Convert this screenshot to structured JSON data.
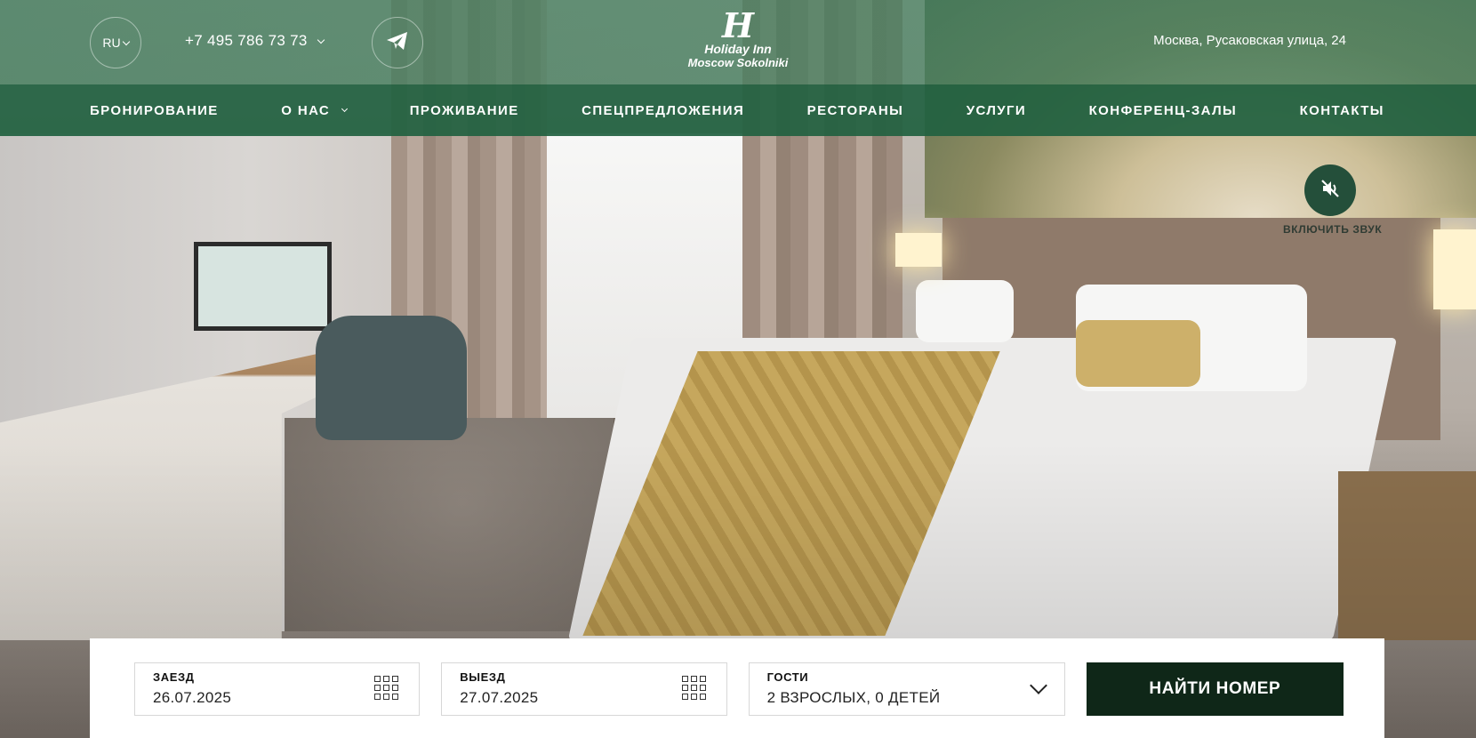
{
  "header": {
    "language": "RU",
    "phone": "+7 495 786 73 73",
    "logo": {
      "mark": "H",
      "brand": "Holiday Inn",
      "subtitle": "Moscow Sokolniki"
    },
    "address": "Москва, Русаковская улица, 24"
  },
  "nav": {
    "items": [
      {
        "label": "БРОНИРОВАНИЕ"
      },
      {
        "label": "О НАС"
      },
      {
        "label": "ПРОЖИВАНИЕ"
      },
      {
        "label": "СПЕЦПРЕДЛОЖЕНИЯ"
      },
      {
        "label": "РЕСТОРАНЫ"
      },
      {
        "label": "УСЛУГИ"
      },
      {
        "label": "КОНФЕРЕНЦ-ЗАЛЫ"
      },
      {
        "label": "КОНТАКТЫ"
      }
    ]
  },
  "hero": {
    "sound_label": "ВКЛЮЧИТЬ ЗВУК"
  },
  "booking": {
    "checkin": {
      "label": "ЗАЕЗД",
      "value": "26.07.2025"
    },
    "checkout": {
      "label": "ВЫЕЗД",
      "value": "27.07.2025"
    },
    "guests": {
      "label": "ГОСТИ",
      "value": "2 ВЗРОСЛЫХ, 0 ДЕТЕЙ"
    },
    "search_label": "НАЙТИ НОМЕР"
  },
  "icons": {
    "language_chevron": "chevron-down-icon",
    "phone_chevron": "chevron-down-icon",
    "telegram": "telegram-icon",
    "sound": "sound-muted-icon",
    "calendar": "calendar-icon",
    "guests_chevron": "chevron-down-icon"
  },
  "colors": {
    "topbar": "#3e7a5a",
    "navbar": "#216140",
    "sound_button": "#244f3a",
    "search_button": "#0f2718"
  }
}
